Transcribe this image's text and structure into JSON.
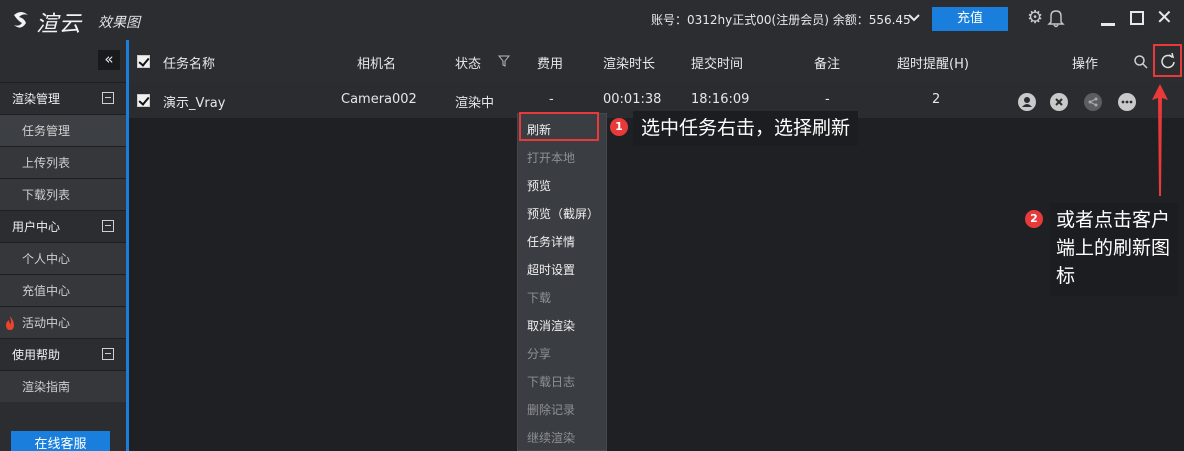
{
  "app": {
    "logo_text": "渲云",
    "logo_sub": "效果图",
    "account_text": "账号：0312hy正式00(注册会员) 余额：556.45",
    "recharge_label": "充值"
  },
  "sidebar": {
    "collapse_label": "«",
    "groups": [
      {
        "label": "渲染管理",
        "items": [
          "任务管理",
          "上传列表",
          "下载列表"
        ]
      },
      {
        "label": "用户中心",
        "items": [
          "个人中心",
          "充值中心",
          "活动中心"
        ]
      },
      {
        "label": "使用帮助",
        "items": [
          "渲染指南"
        ]
      }
    ],
    "service_label": "在线客服"
  },
  "table": {
    "headers": [
      "任务名称",
      "相机名",
      "状态",
      "费用",
      "渲染时长",
      "提交时间",
      "备注",
      "超时提醒(H)",
      "操作"
    ],
    "rows": [
      {
        "name": "演示_Vray",
        "camera": "Camera002",
        "status": "渲染中",
        "cost": "-",
        "duration": "00:01:38",
        "submit_time": "18:16:09",
        "note": "-",
        "timeout": "2"
      }
    ]
  },
  "context_menu": {
    "items": [
      {
        "label": "刷新",
        "enabled": true
      },
      {
        "label": "打开本地",
        "enabled": false
      },
      {
        "label": "预览",
        "enabled": true
      },
      {
        "label": "预览（截屏）",
        "enabled": true
      },
      {
        "label": "任务详情",
        "enabled": true
      },
      {
        "label": "超时设置",
        "enabled": true
      },
      {
        "label": "下载",
        "enabled": false
      },
      {
        "label": "取消渲染",
        "enabled": true
      },
      {
        "label": "分享",
        "enabled": false
      },
      {
        "label": "下载日志",
        "enabled": false
      },
      {
        "label": "删除记录",
        "enabled": false
      },
      {
        "label": "继续渲染",
        "enabled": false
      }
    ]
  },
  "annotations": {
    "badge1": "1",
    "callout1": "选中任务右击，选择刷新",
    "badge2": "2",
    "callout2": "或者点击客户端上的刷新图标"
  },
  "colors": {
    "accent": "#1a7fdc",
    "highlight": "#e83a3a"
  }
}
